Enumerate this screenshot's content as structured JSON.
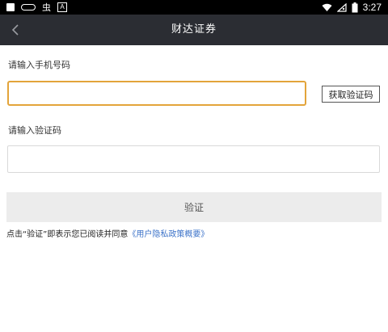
{
  "status_bar": {
    "time": "3:27",
    "icons": [
      "notification-square-icon",
      "pill-icon",
      "bug-icon",
      "a-box-icon",
      "wifi-icon",
      "signal-x-icon",
      "battery-icon"
    ],
    "bug_glyph": "虫",
    "a_glyph": "A"
  },
  "header": {
    "title": "财达证券",
    "back_icon": "chevron-left-icon"
  },
  "form": {
    "phone_label": "请输入手机号码",
    "phone_value": "",
    "get_code_label": "获取验证码",
    "code_label": "请输入验证码",
    "code_value": "",
    "verify_label": "验证"
  },
  "agreement": {
    "prefix": "点击“验证”即表示您已阅读并同意",
    "link": "《用户隐私政策概要》"
  },
  "colors": {
    "status_bar": "#000000",
    "title_bar": "#2b2d33",
    "focus_border": "#e3a43a",
    "link": "#3e74c9",
    "verify_bg": "#ececec"
  }
}
